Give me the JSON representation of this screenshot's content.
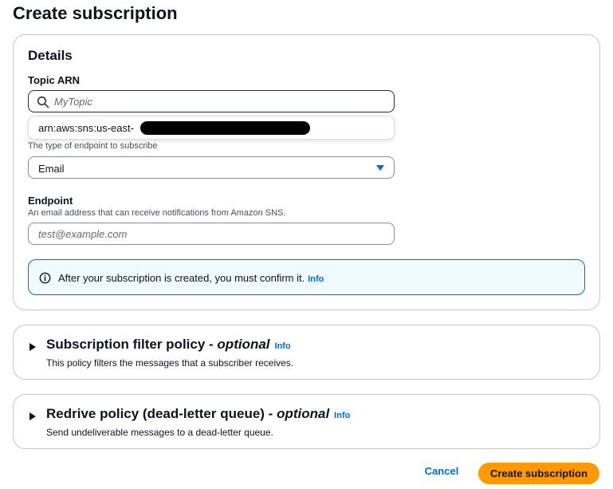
{
  "page": {
    "title": "Create subscription"
  },
  "details": {
    "title": "Details",
    "topic_arn": {
      "label": "Topic ARN",
      "placeholder": "MyTopic",
      "dropdown_option": "arn:aws:sns:us-east-"
    },
    "protocol": {
      "description": "The type of endpoint to subscribe",
      "value": "Email"
    },
    "endpoint": {
      "label": "Endpoint",
      "description": "An email address that can receive notifications from Amazon SNS.",
      "placeholder": "test@example.com"
    },
    "alert": {
      "text": "After your subscription is created, you must confirm it.",
      "link": "Info"
    }
  },
  "filter_policy": {
    "title": "Subscription filter policy - ",
    "optional": "optional",
    "info": "Info",
    "description": "This policy filters the messages that a subscriber receives."
  },
  "redrive_policy": {
    "title": "Redrive policy (dead-letter queue) - ",
    "optional": "optional",
    "info": "Info",
    "description": "Send undeliverable messages to a dead-letter queue."
  },
  "actions": {
    "cancel": "Cancel",
    "create": "Create subscription"
  },
  "colors": {
    "accent": "#006ce0",
    "primary_button": "#ff9900",
    "alert_background": "#f0fbff"
  },
  "icons": [
    "search-icon",
    "info-icon",
    "caret-down-icon",
    "caret-right-icon"
  ]
}
